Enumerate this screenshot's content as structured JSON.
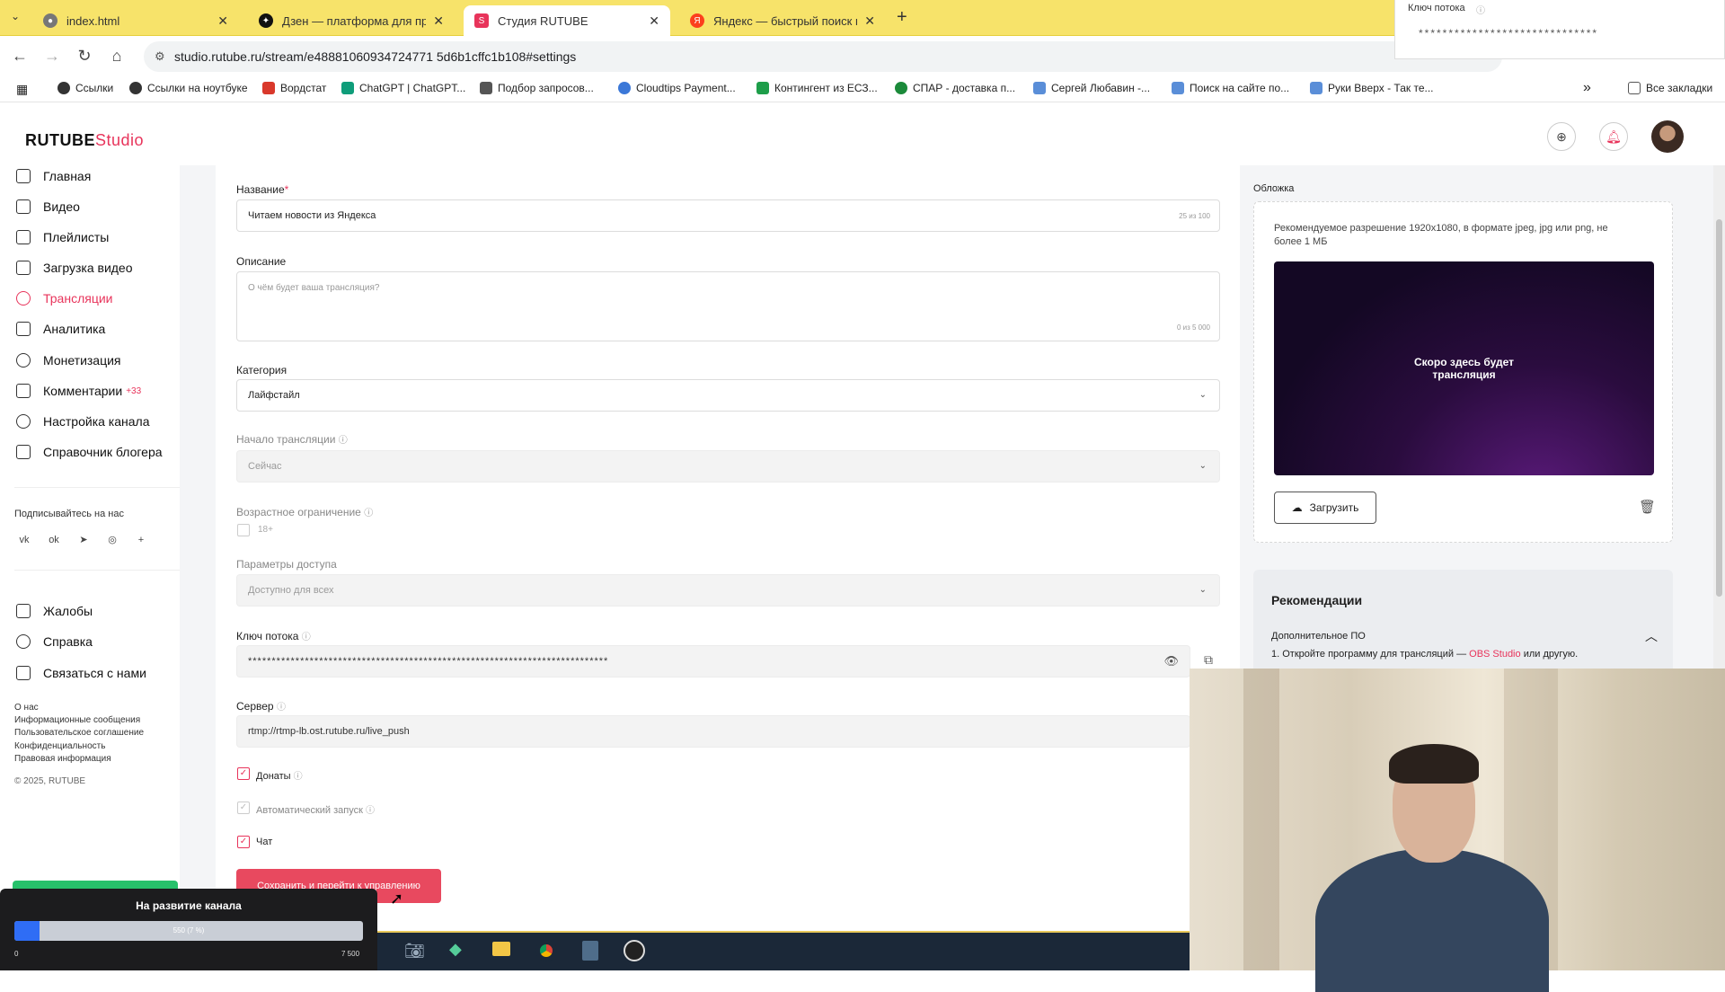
{
  "browser": {
    "tabs": [
      {
        "label": "index.html",
        "fav_color": "#777",
        "glyph": "●"
      },
      {
        "label": "Дзен — платформа для проск",
        "fav_color": "#111",
        "glyph": "✦"
      },
      {
        "label": "Студия RUTUBE",
        "fav_color": "#e8345b",
        "glyph": "S"
      },
      {
        "label": "Яндекс — быстрый поиск в ин",
        "fav_color": "#fc3f1d",
        "glyph": "Я"
      }
    ],
    "url": "studio.rutube.ru/stream/e48881060934724771 5d6b1cffc1b108#settings",
    "bookmarks": [
      {
        "label": "Ссылки",
        "color": "#333"
      },
      {
        "label": "Ссылки на ноутбуке",
        "color": "#333"
      },
      {
        "label": "Вордстат",
        "color": "#d9382b"
      },
      {
        "label": "ChatGPT | ChatGPT...",
        "color": "#0f9d7a"
      },
      {
        "label": "Подбор запросов...",
        "color": "#555"
      },
      {
        "label": "Cloudtips Payment...",
        "color": "#3b78d8"
      },
      {
        "label": "Контингент из ЕСЗ...",
        "color": "#1e9e4a"
      },
      {
        "label": "СПАР - доставка п...",
        "color": "#1b8a3a"
      },
      {
        "label": "Сергей Любавин -...",
        "color": "#5a8ed8"
      },
      {
        "label": "Поиск на сайте по...",
        "color": "#5a8ed8"
      },
      {
        "label": "Руки Вверх - Так те...",
        "color": "#5a8ed8"
      }
    ],
    "all_bookmarks": "Все закладки",
    "more": "»"
  },
  "key_popup": {
    "title": "Ключ потока",
    "value": "******************************"
  },
  "sidebar": {
    "logo_main": "RUTUBE",
    "logo_sub": "Studio",
    "items": [
      {
        "label": "Главная"
      },
      {
        "label": "Видео"
      },
      {
        "label": "Плейлисты"
      },
      {
        "label": "Загрузка видео"
      },
      {
        "label": "Трансляции"
      },
      {
        "label": "Аналитика"
      },
      {
        "label": "Монетизация"
      },
      {
        "label": "Комментарии",
        "badge": "+33"
      },
      {
        "label": "Настройка канала"
      },
      {
        "label": "Справочник блогера"
      }
    ],
    "subscribe": "Подписывайтесь на нас",
    "socials": [
      "vk",
      "ok",
      "➤",
      "◎",
      "+"
    ],
    "bottom_items": [
      {
        "label": "Жалобы"
      },
      {
        "label": "Справка"
      },
      {
        "label": "Связаться с нами"
      }
    ],
    "footer_links": [
      "О нас",
      "Информационные сообщения",
      "Пользовательское соглашение",
      "Конфиденциальность",
      "Правовая информация"
    ],
    "copyright": "© 2025, RUTUBE"
  },
  "form": {
    "title_label": "Название",
    "title_value": "Читаем новости из Яндекса",
    "title_count": "25 из 100",
    "desc_label": "Описание",
    "desc_placeholder": "О чём будет ваша трансляция?",
    "desc_count": "0 из 5 000",
    "category_label": "Категория",
    "category_value": "Лайфстайл",
    "start_label": "Начало трансляции",
    "start_value": "Сейчас",
    "age_label": "Возрастное ограничение",
    "age_value": "18+",
    "access_label": "Параметры доступа",
    "access_value": "Доступно для всех",
    "key_label": "Ключ потока",
    "key_value": "****************************************************************************",
    "server_label": "Сервер",
    "server_value": "rtmp://rtmp-lb.ost.rutube.ru/live_push",
    "donations": "Донаты",
    "autostart": "Автоматический запуск",
    "chat": "Чат",
    "save_button": "Сохранить и перейти к управлению"
  },
  "cover": {
    "label": "Обложка",
    "hint": "Рекомендуемое разрешение 1920х1080, в формате jpeg, jpg или png, не более 1 МБ",
    "preview_text": "Скоро здесь будет трансляция",
    "upload": "Загрузить"
  },
  "recommendations": {
    "title": "Рекомендации",
    "section": "Дополнительное ПО",
    "line_prefix": "1. Откройте программу для трансляций —",
    "line_link": "OBS Studio",
    "line_suffix": "или другую."
  },
  "donation_widget": {
    "title": "На развитие канала",
    "progress_label": "550 (7 %)",
    "progress_fraction": 0.073,
    "min": "0",
    "max": "7 500"
  },
  "colors": {
    "accent": "#e8345b",
    "tabstrip": "#f7e36a"
  }
}
